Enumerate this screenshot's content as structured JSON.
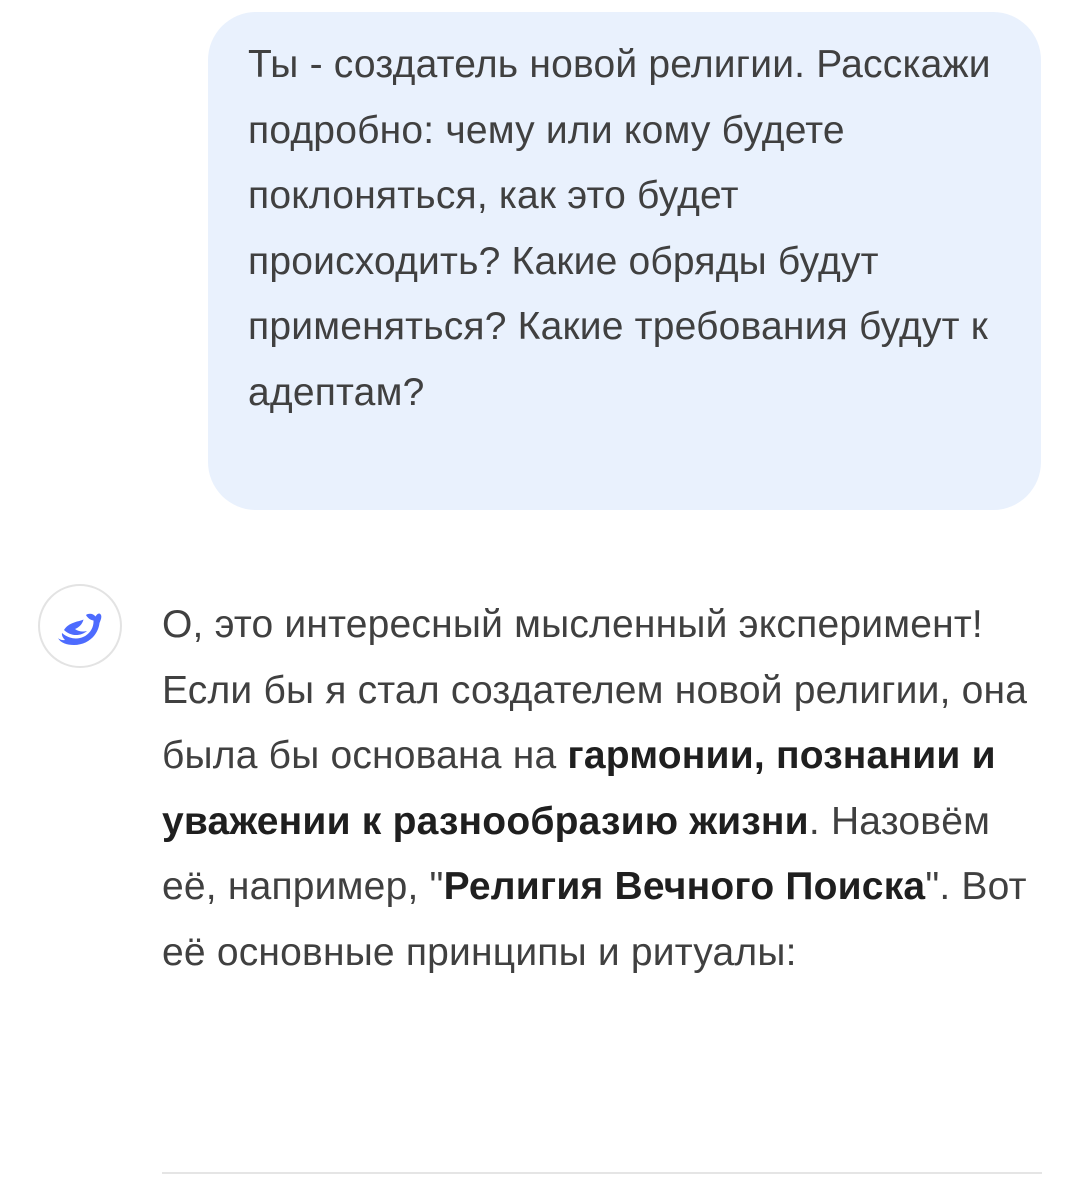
{
  "user_message": {
    "text": "Ты - создатель новой религии. Расскажи подробно: чему или кому будете поклоняться, как это будет происходить? Какие обряды будут применяться? Какие требования будут к адептам?"
  },
  "assistant": {
    "avatar_icon": "deepseek-whale-icon",
    "accent_color": "#4d6bfe",
    "message": {
      "part1": "О, это интересный мысленный эксперимент! Если бы я стал создателем новой религии, она была бы основана на ",
      "bold1": "гармонии, познании и уважении к разнообразию жизни",
      "part2": ". Назовём её, например, \"",
      "bold2": "Религия Вечного Поиска",
      "part3": "\". Вот её основные принципы и ритуалы:"
    }
  },
  "colors": {
    "user_bubble_bg": "#e9f1fd",
    "text": "#404040",
    "bold_text": "#1f1f1f",
    "divider": "#e5e5e5"
  }
}
